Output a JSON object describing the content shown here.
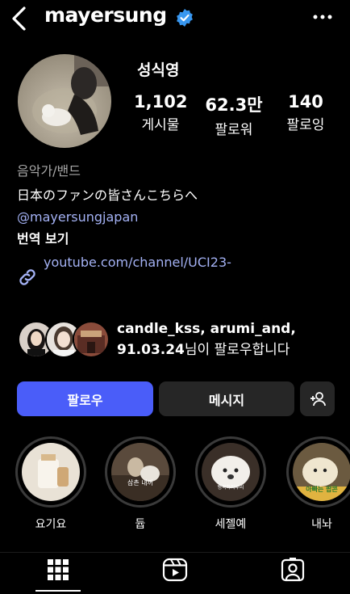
{
  "header": {
    "username": "mayersung",
    "verified": true,
    "icons": {
      "back": "chevron-left-icon",
      "verified": "verified-badge-icon",
      "more": "more-horizontal-icon"
    }
  },
  "profile": {
    "display_name": "성식영",
    "stats": [
      {
        "value": "1,102",
        "label": "게시물"
      },
      {
        "value": "62.3만",
        "label": "팔로워"
      },
      {
        "value": "140",
        "label": "팔로잉"
      }
    ],
    "category": "음악가/밴드",
    "bio": "日本のファンの皆さんこちらへ",
    "mention": "@mayersungjapan",
    "translate": "번역 보기",
    "link": "youtube.com/channel/UCI23-"
  },
  "followed_by": {
    "names": "candle_kss, arumi_and,",
    "date": "91.03.24",
    "suffix": "님이 팔로우합니다"
  },
  "buttons": {
    "follow": "팔로우",
    "message": "메시지",
    "add_user_icon": "add-user-icon"
  },
  "highlights": [
    {
      "label": "요기요",
      "caption": ""
    },
    {
      "label": "듑",
      "caption": "삼촌 내꺼"
    },
    {
      "label": "세젤예",
      "caption": "행복하자우리"
    },
    {
      "label": "내놔",
      "caption": "아빠는 팝콘"
    }
  ],
  "tabs": [
    {
      "icon": "grid-icon"
    },
    {
      "icon": "reels-icon"
    },
    {
      "icon": "tagged-icon"
    }
  ],
  "colors": {
    "accent": "#4a5df9",
    "link": "#a4b2f5",
    "verified": "#3897f0",
    "button_secondary": "#262626"
  }
}
